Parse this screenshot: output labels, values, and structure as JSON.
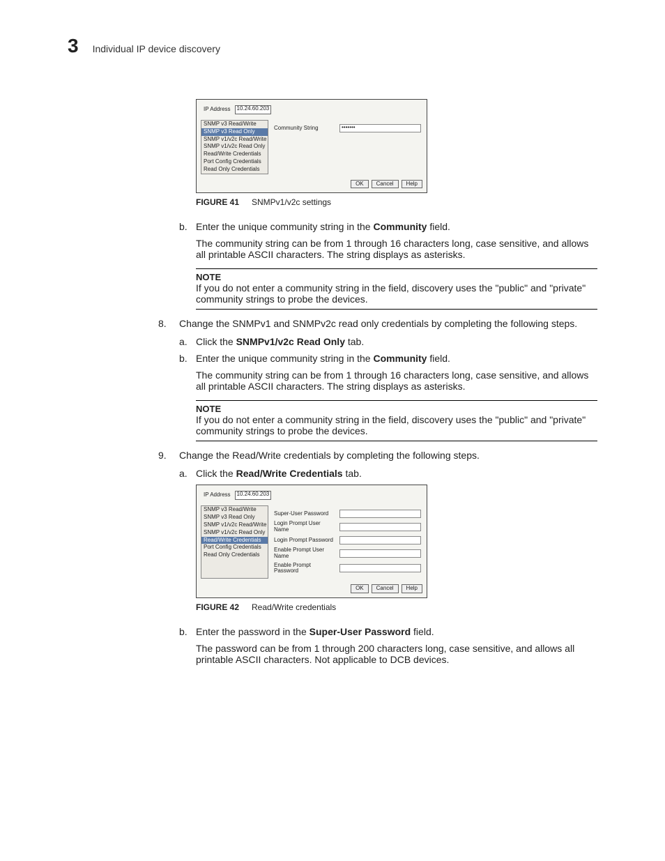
{
  "header": {
    "chapter_number": "3",
    "chapter_title": "Individual IP device discovery"
  },
  "fig41": {
    "ip_label": "IP Address",
    "ip_value": "10.24.60.203",
    "tabs": [
      "SNMP v3 Read/Write",
      "SNMP v3 Read Only",
      "SNMP v1/v2c Read/Write",
      "SNMP v1/v2c Read Only",
      "Read/Write Credentials",
      "Port Config Credentials",
      "Read Only Credentials"
    ],
    "selected_idx": 1,
    "field_label": "Community String",
    "field_value": "•••••••",
    "buttons": {
      "ok": "OK",
      "cancel": "Cancel",
      "help": "Help"
    },
    "caption_label": "FIGURE 41",
    "caption_text": "SNMPv1/v2c settings"
  },
  "fig42": {
    "ip_label": "IP Address",
    "ip_value": "10.24.60.203",
    "tabs": [
      "SNMP v3 Read/Write",
      "SNMP v3 Read Only",
      "SNMP v1/v2c Read/Write",
      "SNMP v1/v2c Read Only",
      "Read/Write Credentials",
      "Port Config Credentials",
      "Read Only Credentials"
    ],
    "selected_idx": 4,
    "fields": [
      "Super-User Password",
      "Login Prompt User Name",
      "Login Prompt Password",
      "Enable Prompt User Name",
      "Enable Prompt Password"
    ],
    "buttons": {
      "ok": "OK",
      "cancel": "Cancel",
      "help": "Help"
    },
    "caption_label": "FIGURE 42",
    "caption_text": "Read/Write credentials"
  },
  "body": {
    "s7b_marker": "b.",
    "s7b_pre": "Enter the unique community string in the ",
    "s7b_bold": "Community",
    "s7b_post": " field.",
    "s7b_para": "The community string can be from 1 through 16 characters long, case sensitive, and allows all printable ASCII characters. The string displays as asterisks.",
    "note_title": "NOTE",
    "note7": "If you do not enter a community string in the field, discovery uses the \"public\" and \"private\" community strings to probe the devices.",
    "s8_marker": "8.",
    "s8_text": "Change the SNMPv1 and SNMPv2c read only credentials by completing the following steps.",
    "s8a_marker": "a.",
    "s8a_pre": "Click the ",
    "s8a_bold": "SNMPv1/v2c Read Only",
    "s8a_post": " tab.",
    "s8b_marker": "b.",
    "s8b_pre": "Enter the unique community string in the ",
    "s8b_bold": "Community",
    "s8b_post": " field.",
    "s8b_para": "The community string can be from 1 through 16 characters long, case sensitive, and allows all printable ASCII characters. The string displays as asterisks.",
    "note8": "If you do not enter a community string in the field, discovery uses the \"public\" and \"private\" community strings to probe the devices.",
    "s9_marker": "9.",
    "s9_text": "Change the Read/Write credentials by completing the following steps.",
    "s9a_marker": "a.",
    "s9a_pre": "Click the ",
    "s9a_bold": "Read/Write Credentials",
    "s9a_post": " tab.",
    "s9b_marker": "b.",
    "s9b_pre": "Enter the password in the ",
    "s9b_bold": "Super-User Password",
    "s9b_post": " field.",
    "s9b_para": "The password can be from 1 through 200 characters long, case sensitive, and allows all printable ASCII characters. Not applicable to DCB devices."
  }
}
